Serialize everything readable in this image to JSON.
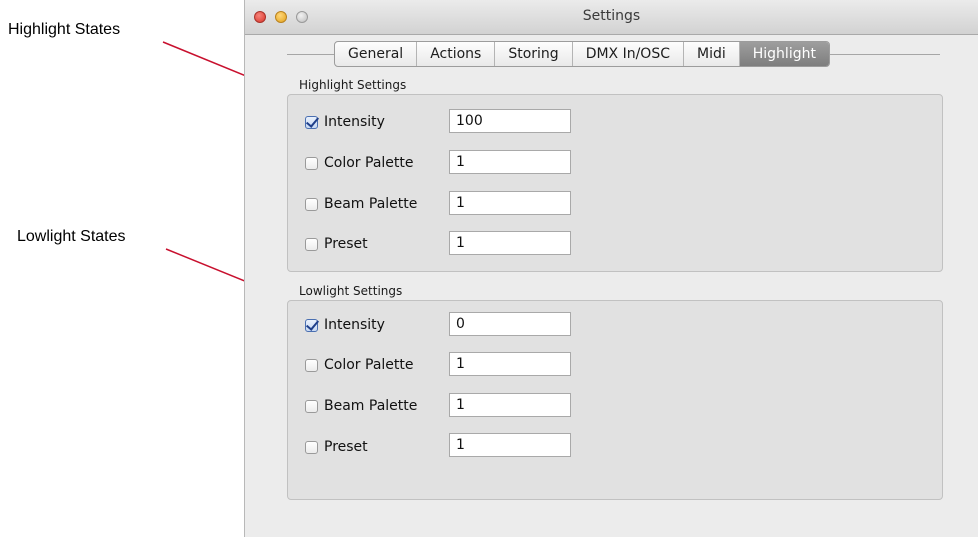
{
  "callouts": {
    "highlight": "Highlight States",
    "lowlight": "Lowlight States"
  },
  "window": {
    "title": "Settings"
  },
  "tabs": [
    "General",
    "Actions",
    "Storing",
    "DMX In/OSC",
    "Midi",
    "Highlight"
  ],
  "active_tab": "Highlight",
  "highlight": {
    "label": "Highlight Settings",
    "rows": [
      {
        "label": "Intensity",
        "checked": true,
        "value": "100"
      },
      {
        "label": "Color Palette",
        "checked": false,
        "value": "1"
      },
      {
        "label": "Beam Palette",
        "checked": false,
        "value": "1"
      },
      {
        "label": "Preset",
        "checked": false,
        "value": "1"
      }
    ]
  },
  "lowlight": {
    "label": "Lowlight Settings",
    "rows": [
      {
        "label": "Intensity",
        "checked": true,
        "value": "0"
      },
      {
        "label": "Color Palette",
        "checked": false,
        "value": "1"
      },
      {
        "label": "Beam Palette",
        "checked": false,
        "value": "1"
      },
      {
        "label": "Preset",
        "checked": false,
        "value": "1"
      }
    ]
  },
  "colors": {
    "arrow": "#c8102e",
    "active_tab": "#8a8a8a"
  }
}
